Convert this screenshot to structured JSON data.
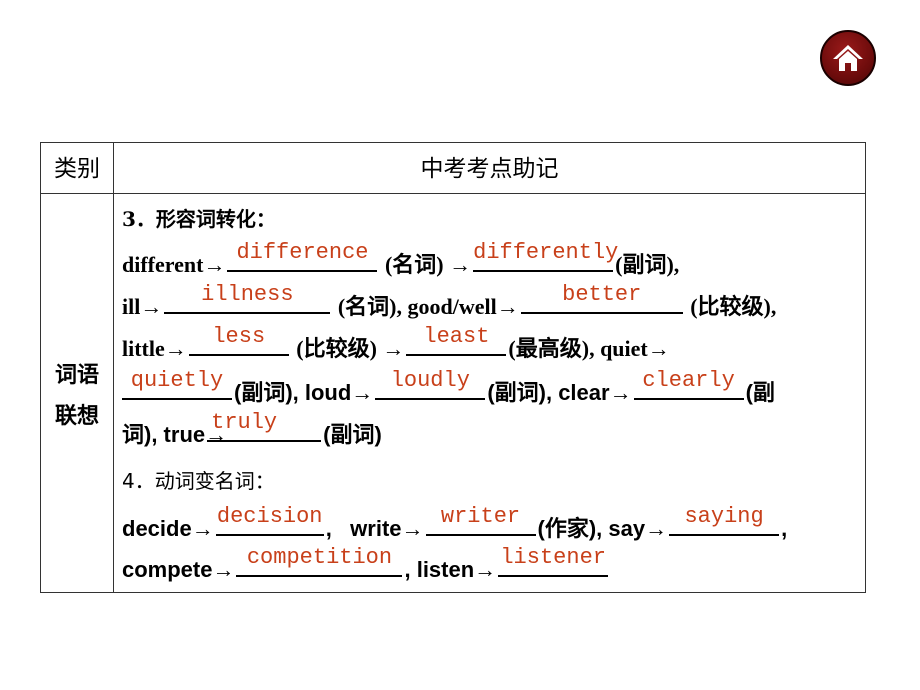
{
  "nav": {
    "home_icon": "home-icon",
    "accent_color": "#7a1010"
  },
  "table": {
    "header": {
      "category": "类别",
      "title": "中考考点助记"
    },
    "category_label_line1": "词语",
    "category_label_line2": "联想",
    "answer_color": "#c8401a",
    "section3": {
      "heading": "3．形容词转化：",
      "different": "different→",
      "different_ans": "difference",
      "noun1": "(名词) →",
      "differently_ans": "differently",
      "adv1": "(副词),",
      "ill": "ill→",
      "ill_ans": "illness",
      "noun2": "(名词), good/well→",
      "better_ans": "better",
      "comp1": "(比较级),",
      "little": "little→",
      "less_ans": "less",
      "comp2": "(比较级) →",
      "least_ans": "least",
      "sup": "(最高级), quiet→",
      "quietly_ans": "quietly",
      "adv2": "(副词), loud→",
      "loudly_ans": "loudly",
      "adv3": "(副词), clear→",
      "clearly_ans": "clearly",
      "adv4a": "(副",
      "adv4b": "词), true→",
      "truly_ans": "truly",
      "adv5": "(副词)"
    },
    "section4": {
      "heading": "4．动词变名词：",
      "decide": "decide→",
      "decision_ans": "decision",
      "write": ",   write→",
      "writer_ans": "writer",
      "writer_note": "(作家), say→",
      "saying_ans": "saying",
      "comma": ",",
      "compete": "compete→",
      "competition_ans": "competition",
      "listen": ", listen→",
      "listener_ans": "listener"
    }
  }
}
